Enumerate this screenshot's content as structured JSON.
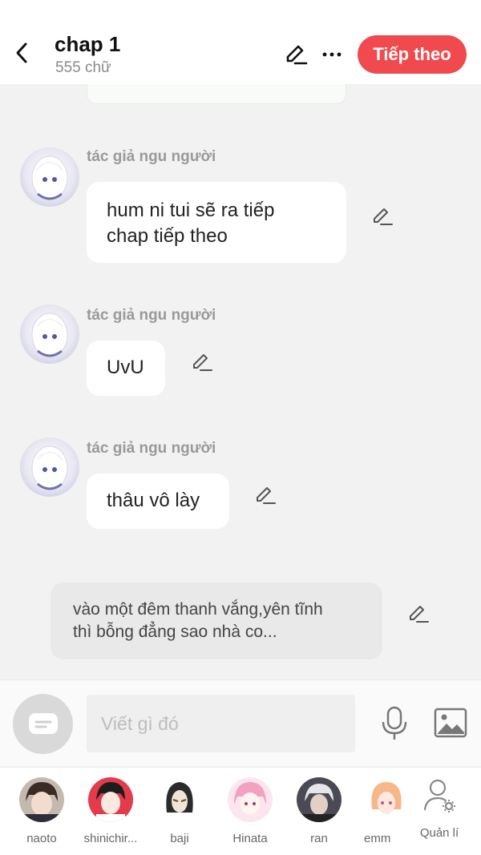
{
  "header": {
    "title": "chap 1",
    "subtitle": "555 chữ",
    "next_label": "Tiếp theo",
    "accent": "#f04a4f"
  },
  "messages": [
    {
      "author": "tác giả ngu người",
      "text_lines": [
        "hum ni tui sẽ ra tiếp",
        "chap tiếp theo"
      ]
    },
    {
      "author": "tác giả ngu người",
      "text_lines": [
        "UvU"
      ]
    },
    {
      "author": "tác giả ngu người",
      "text_lines": [
        "thâu vô lày"
      ]
    }
  ],
  "narration": {
    "text_lines": [
      "vào một đêm thanh vắng,yên tĩnh",
      "thì bỗng đẳng sao nhà co..."
    ]
  },
  "composer": {
    "placeholder": "Viết gì đó"
  },
  "characters": [
    {
      "name": "naoto"
    },
    {
      "name": "shinichir..."
    },
    {
      "name": "baji"
    },
    {
      "name": "Hinata"
    },
    {
      "name": "ran"
    },
    {
      "name": "emm"
    }
  ],
  "manage_label": "Quản lí",
  "icons": {
    "back": "chevron-left-icon",
    "edit": "pencil-icon",
    "more": "more-horizontal-icon",
    "mic": "microphone-icon",
    "image": "image-icon",
    "chat_toggle": "chat-bubble-icon",
    "manage": "user-settings-icon"
  }
}
